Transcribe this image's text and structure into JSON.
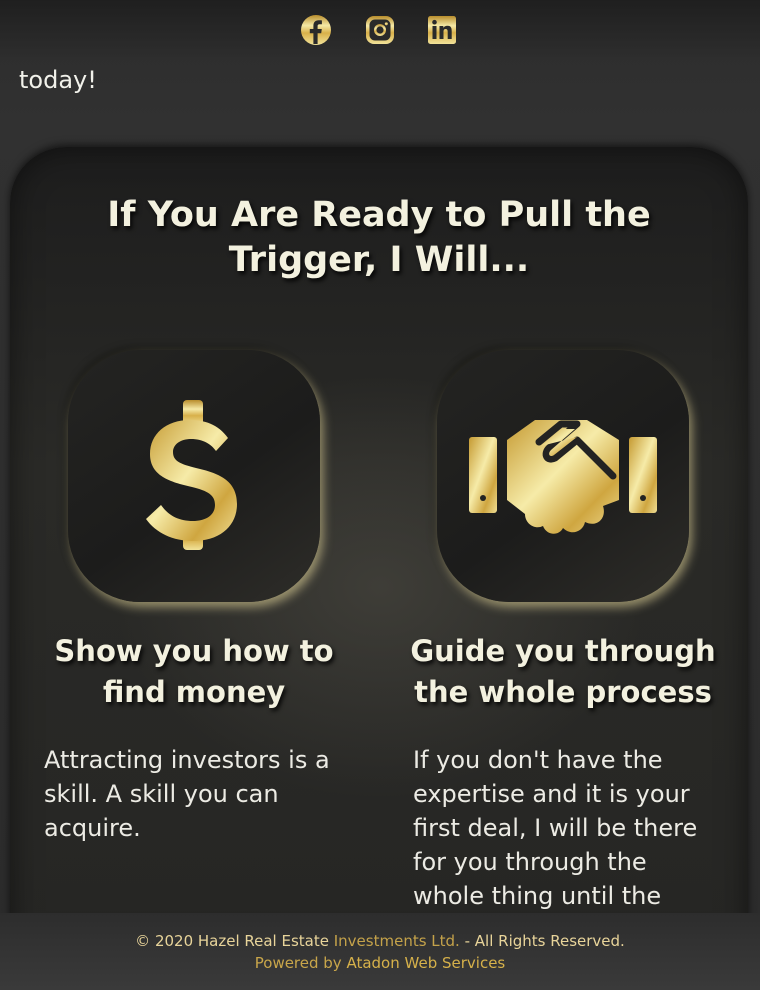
{
  "social": {
    "items": [
      {
        "name": "facebook",
        "icon": "facebook-icon"
      },
      {
        "name": "instagram",
        "icon": "instagram-icon"
      },
      {
        "name": "linkedin",
        "icon": "linkedin-icon"
      }
    ],
    "color": "#d8b64f"
  },
  "intro": {
    "text": "today!"
  },
  "section": {
    "title": "If You Are Ready to Pull the Trigger, I Will...",
    "features": [
      {
        "icon": "dollar-sign-icon",
        "title": "Show you how to find money",
        "body": "Attracting investors is a skill. A skill you can acquire."
      },
      {
        "icon": "handshake-icon",
        "title": "Guide you through the whole process",
        "body": "If you don't have the expertise and it is your first deal, I will be there for you through the whole thing until the end"
      }
    ]
  },
  "footer": {
    "copyright_prefix": "© 2020 Hazel Real Estate ",
    "copyright_link": "Investments Ltd.",
    "copyright_suffix": " - All Rights Reserved.",
    "powered_prefix": "Powered by ",
    "powered_link": "Atadon Web Services"
  },
  "colors": {
    "gold": "#d8b64f",
    "gold_light": "#f3e49a",
    "text_light": "#f3f1df",
    "background": "#2a2a2a"
  }
}
